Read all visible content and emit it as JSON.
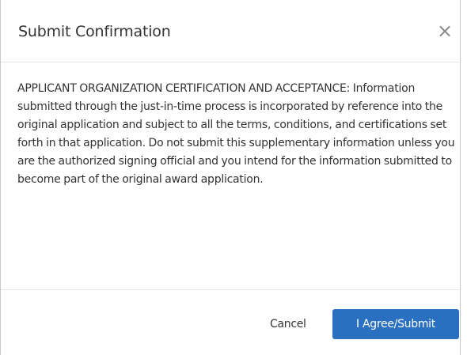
{
  "dialog": {
    "title": "Submit Confirmation",
    "close_glyph": "×",
    "close_icon": "close-icon",
    "body_text": "APPLICANT ORGANIZATION CERTIFICATION AND ACCEPTANCE: Information submitted through the just-in-time process is incorporated by reference into the original application and subject to all the terms, conditions, and certifications set forth in that application. Do not submit this supplementary information unless you are the authorized signing official and you intend for the information submitted to become part of the original award application.",
    "cancel_label": "Cancel",
    "agree_label": "I Agree/Submit"
  },
  "colors": {
    "primary_button": "#2a70c0",
    "text": "#333333",
    "divider": "#e5e5e5"
  }
}
